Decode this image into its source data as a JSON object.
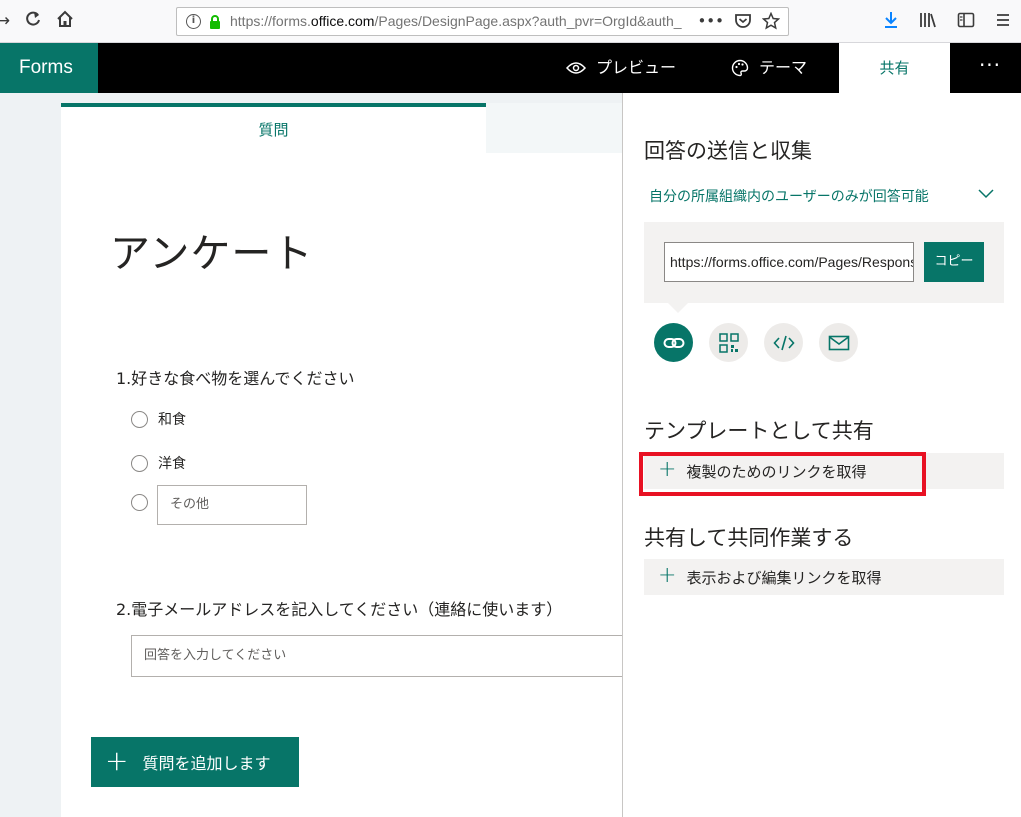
{
  "browser": {
    "url_prefix": "https://forms.",
    "url_domain": "office.com",
    "url_rest": "/Pages/DesignPage.aspx?auth_pvr=OrgId&auth_",
    "url_more": "•••"
  },
  "header": {
    "brand": "Forms",
    "preview_label": "プレビュー",
    "theme_label": "テーマ",
    "share_label": "共有",
    "more_label": "···"
  },
  "form": {
    "tab_questions": "質問",
    "title": "アンケート",
    "questions": [
      {
        "title": "1.好きな食べ物を選んでください",
        "choices": [
          "和食",
          "洋食"
        ],
        "other_placeholder": "その他"
      },
      {
        "title": "2.電子メールアドレスを記入してください（連絡に使います）",
        "answer_placeholder": "回答を入力してください"
      }
    ],
    "add_question_label": "質問を追加します"
  },
  "share_panel": {
    "send_heading": "回答の送信と収集",
    "scope_label": "自分の所属組織内のユーザーのみが回答可能",
    "link_value": "https://forms.office.com/Pages/ResponsePage.aspx",
    "copy_label": "コピー",
    "share_options": [
      "link-icon",
      "qr-code-icon",
      "embed-code-icon",
      "email-icon"
    ],
    "template_heading": "テンプレートとして共有",
    "duplicate_link_label": "複製のためのリンクを取得",
    "collaborate_heading": "共有して共同作業する",
    "edit_link_label": "表示および編集リンクを取得"
  },
  "colors": {
    "accent": "#077568",
    "highlight": "#e81123"
  }
}
